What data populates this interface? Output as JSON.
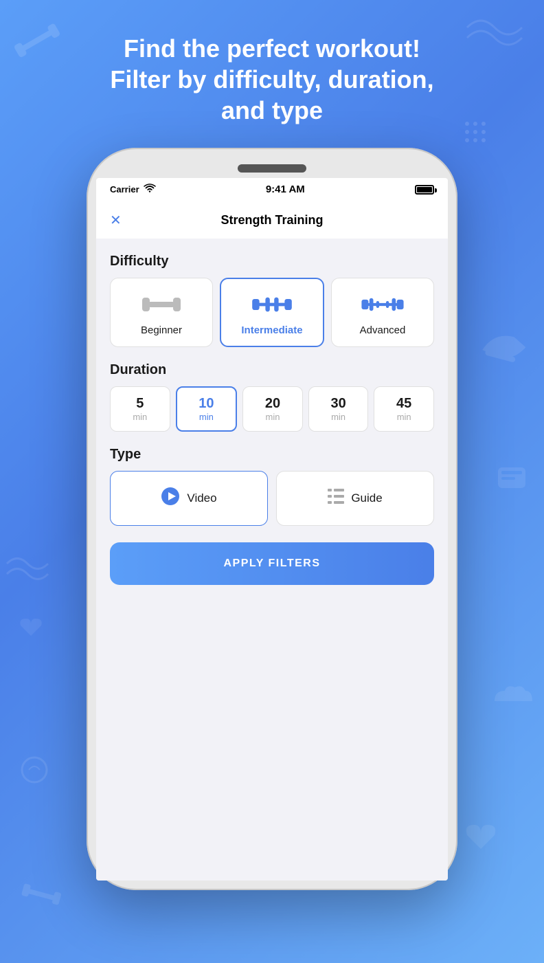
{
  "hero": {
    "line1": "Find the perfect workout!",
    "line2": "Filter by difficulty, duration,",
    "line3": "and type"
  },
  "statusBar": {
    "carrier": "Carrier",
    "time": "9:41 AM"
  },
  "app": {
    "title": "Strength Training",
    "close_label": "✕",
    "sections": {
      "difficulty": {
        "label": "Difficulty",
        "options": [
          {
            "id": "beginner",
            "label": "Beginner",
            "selected": false,
            "bars": 1
          },
          {
            "id": "intermediate",
            "label": "Intermediate",
            "selected": true,
            "bars": 2
          },
          {
            "id": "advanced",
            "label": "Advanced",
            "selected": false,
            "bars": 3
          }
        ]
      },
      "duration": {
        "label": "Duration",
        "options": [
          {
            "value": "5",
            "unit": "min",
            "selected": false
          },
          {
            "value": "10",
            "unit": "min",
            "selected": true
          },
          {
            "value": "20",
            "unit": "min",
            "selected": false
          },
          {
            "value": "30",
            "unit": "min",
            "selected": false
          },
          {
            "value": "45",
            "unit": "min",
            "selected": false
          }
        ]
      },
      "type": {
        "label": "Type",
        "options": [
          {
            "id": "video",
            "label": "Video",
            "selected": true,
            "icon": "▶"
          },
          {
            "id": "guide",
            "label": "Guide",
            "selected": false,
            "icon": "≡"
          }
        ]
      }
    },
    "applyButton": "APPLY FILTERS"
  }
}
